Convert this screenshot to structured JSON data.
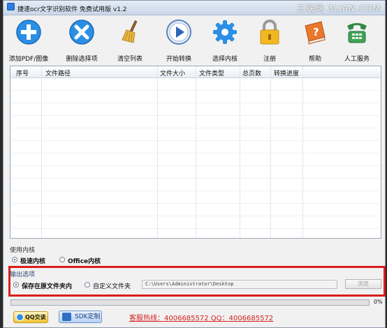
{
  "window": {
    "title": "捷速ocr文字识别软件 免费试用版 v1.2",
    "watermark": "三联网 3LIAN.COM"
  },
  "toolbar": {
    "items": [
      {
        "label": "添加PDF/图像",
        "icon": "add-icon"
      },
      {
        "label": "删除选择项",
        "icon": "delete-icon"
      },
      {
        "label": "清空列表",
        "icon": "broom-icon"
      },
      {
        "label": "开始转换",
        "icon": "play-icon"
      },
      {
        "label": "选择内核",
        "icon": "gear-icon"
      },
      {
        "label": "注册",
        "icon": "lock-icon"
      },
      {
        "label": "帮助",
        "icon": "help-book-icon"
      },
      {
        "label": "人工服务",
        "icon": "phone-icon"
      }
    ]
  },
  "file_table": {
    "columns": [
      "序号",
      "文件路径",
      "文件大小",
      "文件类型",
      "总页数",
      "转换进度"
    ],
    "rows": []
  },
  "core": {
    "section_label": "使用内核",
    "options": [
      {
        "label": "极速内核",
        "checked": true
      },
      {
        "label": "Office内核",
        "checked": false
      }
    ]
  },
  "output": {
    "section_label": "输出选项",
    "options": [
      {
        "label": "保存在原文件夹内",
        "checked": true
      },
      {
        "label": "自定义文件夹",
        "checked": false
      }
    ],
    "path_value": "C:\\Users\\Administrator\\Desktop",
    "browse_label": "浏览"
  },
  "progress": {
    "value_percent": 0,
    "label": "0%"
  },
  "footer": {
    "chat_label": "QQ交谈",
    "sdk_label": "SDK定制",
    "hotline": "客服热线：4006685572 QQ：4006685572"
  },
  "colors": {
    "accent": "#3b7fe0",
    "highlight_box": "#d81e1e",
    "hotline": "#d62222"
  }
}
